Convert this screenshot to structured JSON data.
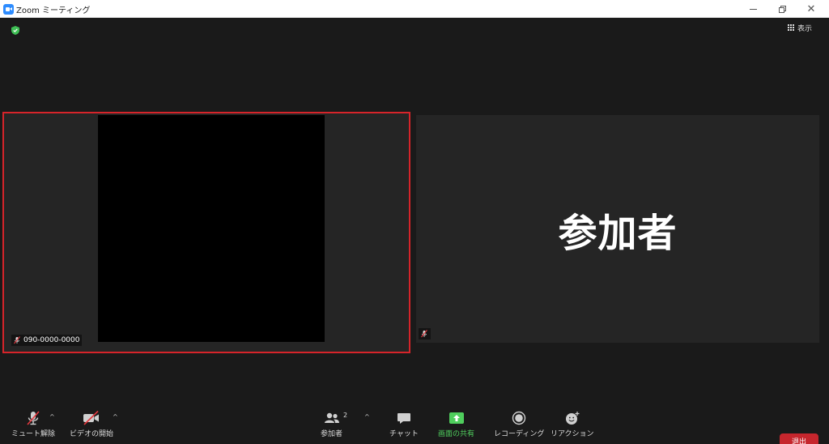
{
  "window": {
    "title": "Zoom ミーティング",
    "controls": {
      "minimize": "minimize",
      "maximize": "restore",
      "close": "✕"
    }
  },
  "top_bar": {
    "security_icon": "shield-icon",
    "view_label": "表示"
  },
  "tiles": [
    {
      "name": "090-0000-0000",
      "muted": true,
      "active_speaker": true
    },
    {
      "display_name": "参加者",
      "muted": true
    }
  ],
  "toolbar": {
    "unmute_label": "ミュート解除",
    "start_video_label": "ビデオの開始",
    "participants_label": "参加者",
    "participants_count": "2",
    "chat_label": "チャット",
    "share_screen_label": "画面の共有",
    "recording_label": "レコーディング",
    "reactions_label": "リアクション",
    "leave_label": "退出"
  },
  "colors": {
    "background": "#1a1a1a",
    "tile": "#252525",
    "active_outline": "#d6242a",
    "share_green": "#4fce5d",
    "leave_red": "#c6262d",
    "brand_blue": "#2d8cff"
  }
}
